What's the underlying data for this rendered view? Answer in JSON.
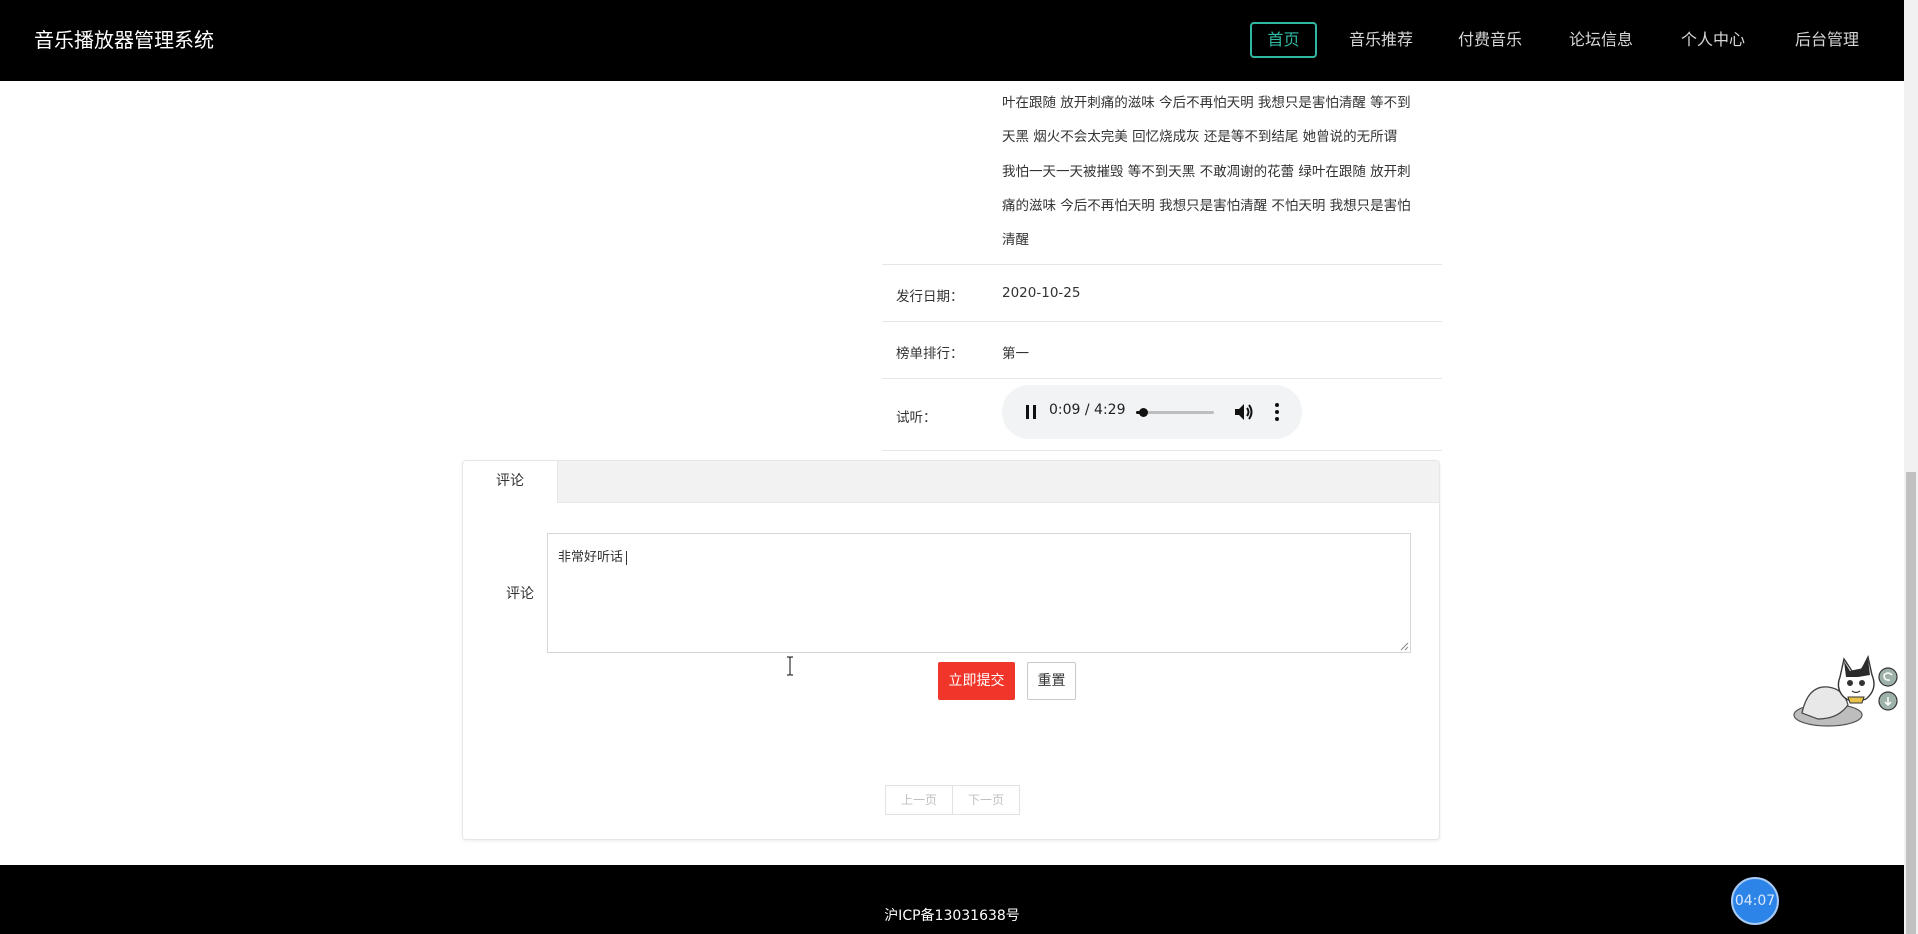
{
  "header": {
    "brand": "音乐播放器管理系统",
    "nav": [
      {
        "label": "首页",
        "active": true
      },
      {
        "label": "音乐推荐",
        "active": false
      },
      {
        "label": "付费音乐",
        "active": false
      },
      {
        "label": "论坛信息",
        "active": false
      },
      {
        "label": "个人中心",
        "active": false
      },
      {
        "label": "后台管理",
        "active": false
      }
    ]
  },
  "detail": {
    "lyrics_lines": [
      "叶在跟随 放开刺痛的滋味 今后不再怕天明 我想只是害怕清醒 等不到",
      "天黑 烟火不会太完美 回忆烧成灰 还是等不到结尾 她曾说的无所谓",
      "我怕一天一天被摧毁 等不到天黑 不敢凋谢的花蕾 绿叶在跟随 放开刺",
      "痛的滋味 今后不再怕天明 我想只是害怕清醒 不怕天明 我想只是害怕",
      "清醒"
    ],
    "release_label": "发行日期：",
    "release_value": "2020-10-25",
    "rank_label": "榜单排行：",
    "rank_value": "第一",
    "preview_label": "试听："
  },
  "audio": {
    "time_text": "0:09 / 4:29",
    "progress": 0.035
  },
  "comments": {
    "tab_label": "评论",
    "field_label": "评论",
    "textarea_value": "非常好听话",
    "submit_label": "立即提交",
    "reset_label": "重置",
    "prev_label": "上一页",
    "next_label": "下一页"
  },
  "footer": {
    "icp": "沪ICP备13031638号"
  },
  "widget": {
    "clock_text": "04:07"
  },
  "colors": {
    "accent": "#2fb9a3",
    "submit": "#f0362a",
    "header_bg": "#000000",
    "clock": "#2c84e8"
  }
}
